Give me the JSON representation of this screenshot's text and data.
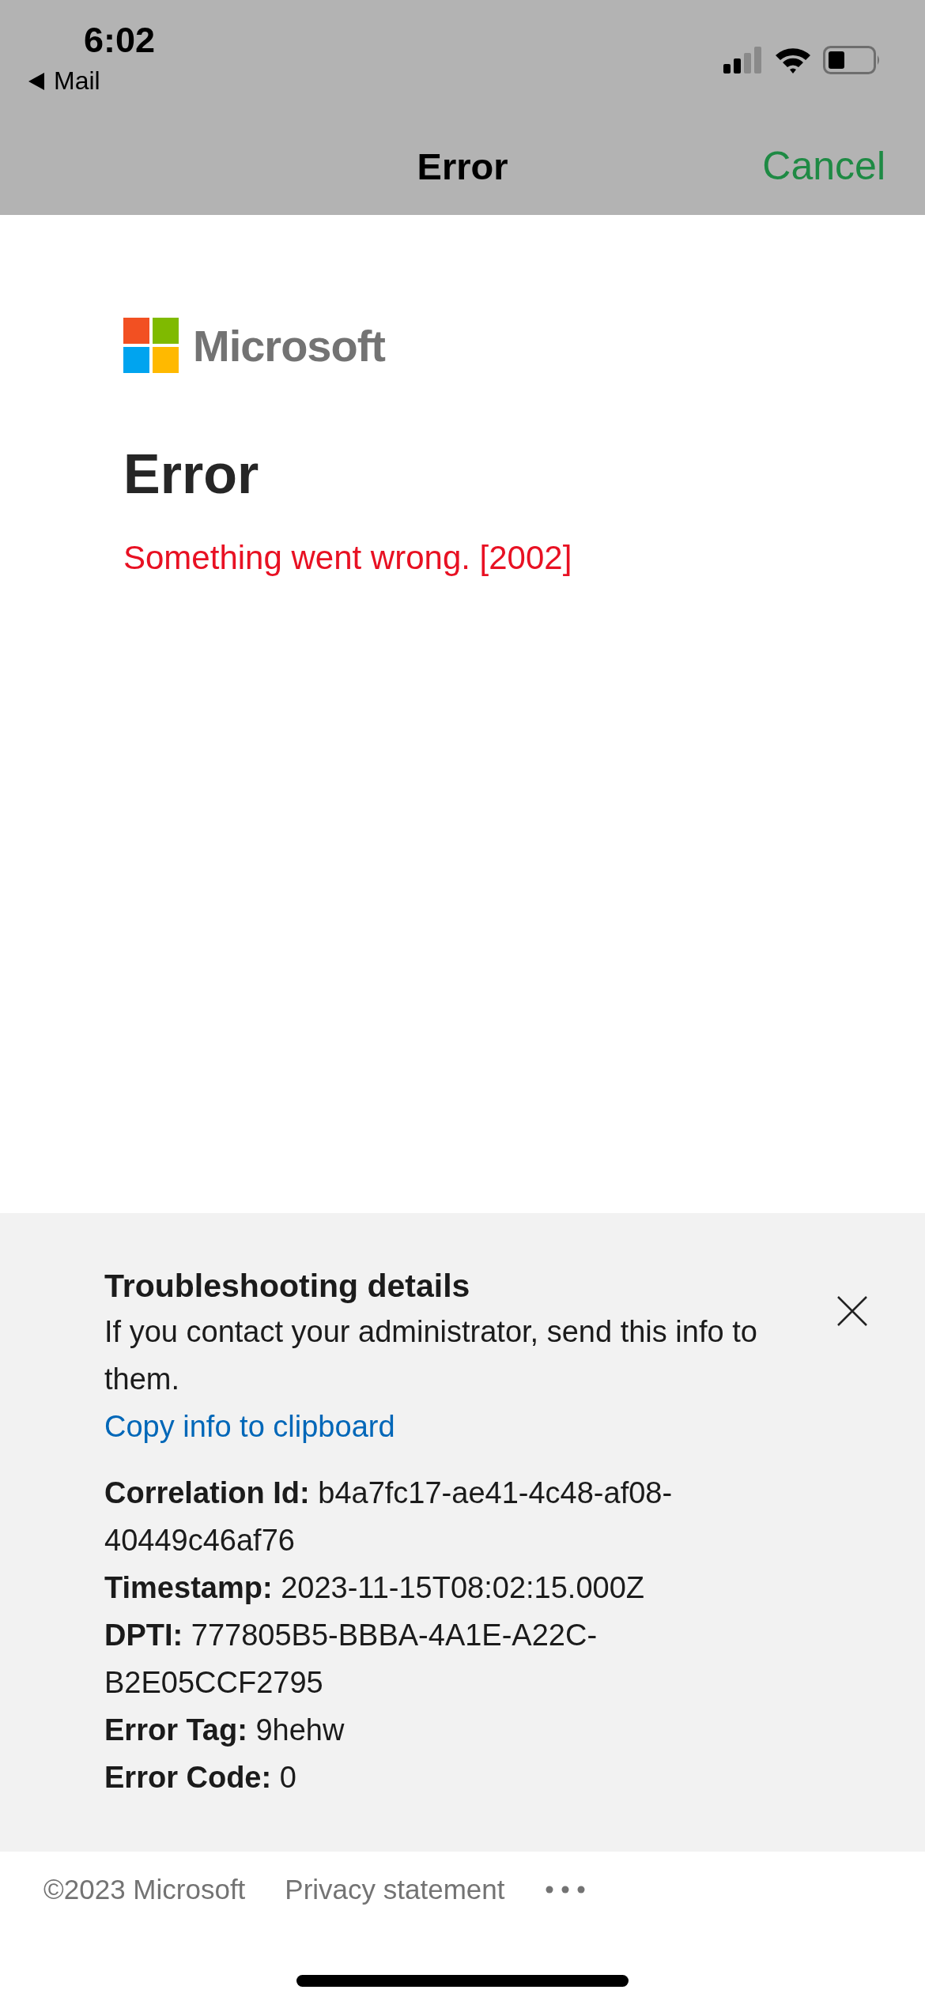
{
  "status_bar": {
    "time": "6:02",
    "back_label": "Mail"
  },
  "nav": {
    "title": "Error",
    "cancel": "Cancel"
  },
  "logo": {
    "text": "Microsoft"
  },
  "heading": "Error",
  "message": "Something went wrong. [2002]",
  "troubleshooting": {
    "title": "Troubleshooting details",
    "description": "If you contact your administrator, send this info to them.",
    "copy_link": "Copy info to clipboard",
    "details": [
      {
        "label": "Correlation Id:",
        "value": "b4a7fc17-ae41-4c48-af08-40449c46af76"
      },
      {
        "label": "Timestamp:",
        "value": "2023-11-15T08:02:15.000Z"
      },
      {
        "label": "DPTI:",
        "value": "777805B5-BBBA-4A1E-A22C-B2E05CCF2795"
      },
      {
        "label": "Error Tag:",
        "value": "9hehw"
      },
      {
        "label": "Error Code:",
        "value": "0"
      }
    ]
  },
  "footer": {
    "copyright": "©2023 Microsoft",
    "privacy": "Privacy statement"
  }
}
